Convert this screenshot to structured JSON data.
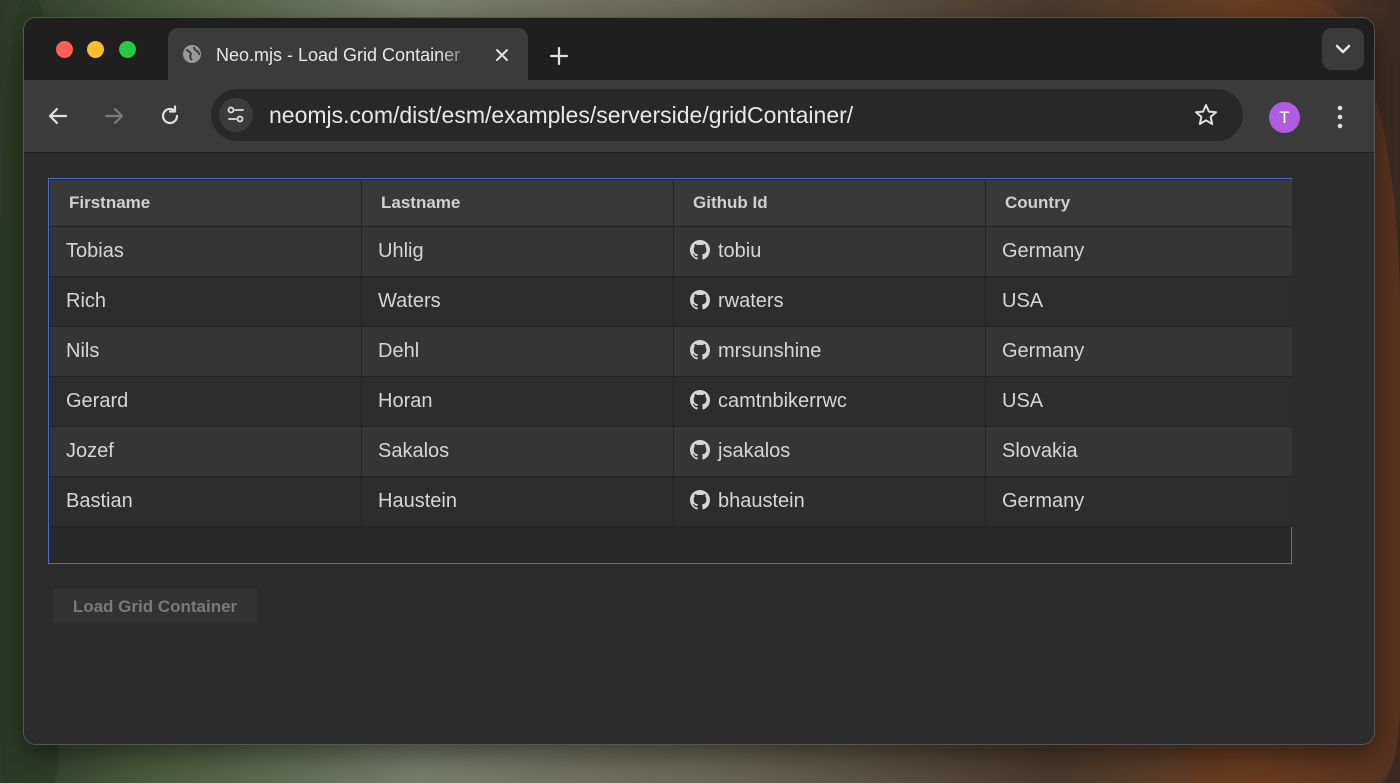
{
  "browser": {
    "tab_title": "Neo.mjs - Load Grid Container",
    "url": "neomjs.com/dist/esm/examples/serverside/gridContainer/",
    "avatar_initial": "T",
    "avatar_color": "#b05ce0"
  },
  "grid": {
    "border_color": "#4a6dd4",
    "columns": [
      "Firstname",
      "Lastname",
      "Github Id",
      "Country"
    ],
    "rows": [
      {
        "firstname": "Tobias",
        "lastname": "Uhlig",
        "github": "tobiu",
        "country": "Germany"
      },
      {
        "firstname": "Rich",
        "lastname": "Waters",
        "github": "rwaters",
        "country": "USA"
      },
      {
        "firstname": "Nils",
        "lastname": "Dehl",
        "github": "mrsunshine",
        "country": "Germany"
      },
      {
        "firstname": "Gerard",
        "lastname": "Horan",
        "github": "camtnbikerrwc",
        "country": "USA"
      },
      {
        "firstname": "Jozef",
        "lastname": "Sakalos",
        "github": "jsakalos",
        "country": "Slovakia"
      },
      {
        "firstname": "Bastian",
        "lastname": "Haustein",
        "github": "bhaustein",
        "country": "Germany"
      }
    ],
    "github_icon": "github-icon"
  },
  "actions": {
    "load_button_label": "Load Grid Container"
  }
}
